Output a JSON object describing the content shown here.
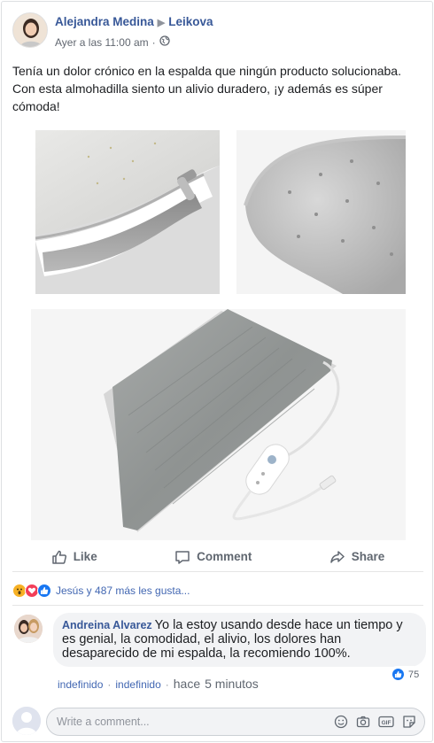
{
  "post": {
    "author": "Alejandra Medina",
    "target": "Leikova",
    "timestamp": "Ayer a las 11:00 am",
    "meta_separator": "·",
    "text": "Tenía un dolor crónico en la espalda que ningún producto solucionaba. Con esta almohadilla siento un alivio duradero, ¡y además es súper cómoda!"
  },
  "actions": {
    "like": "Like",
    "comment": "Comment",
    "share": "Share"
  },
  "reactions": {
    "summary": "Jesús y 487 más les gusta..."
  },
  "comment": {
    "author": "Andreina Alvarez",
    "text": "Yo la estoy usando desde hace un tiempo y es genial, la comodidad, el alivio, los dolores han desaparecido de mi espalda, la recomiendo 100%.",
    "likes": "75",
    "action1": "indefinido",
    "action2": "indefinido",
    "sep": "·",
    "time_prefix": "hace",
    "time_value": "5 minutos"
  },
  "composer": {
    "placeholder": "Write a comment..."
  },
  "icons": [
    "globe-icon",
    "like-icon",
    "comment-icon",
    "share-icon",
    "emoji-icon",
    "camera-icon",
    "gif-icon",
    "sticker-icon"
  ],
  "colors": {
    "link": "#385898",
    "accent": "#4267b2",
    "like_blue": "#1877f2",
    "love": "#f33e58",
    "wow": "#f7b125",
    "muted": "#606770"
  }
}
